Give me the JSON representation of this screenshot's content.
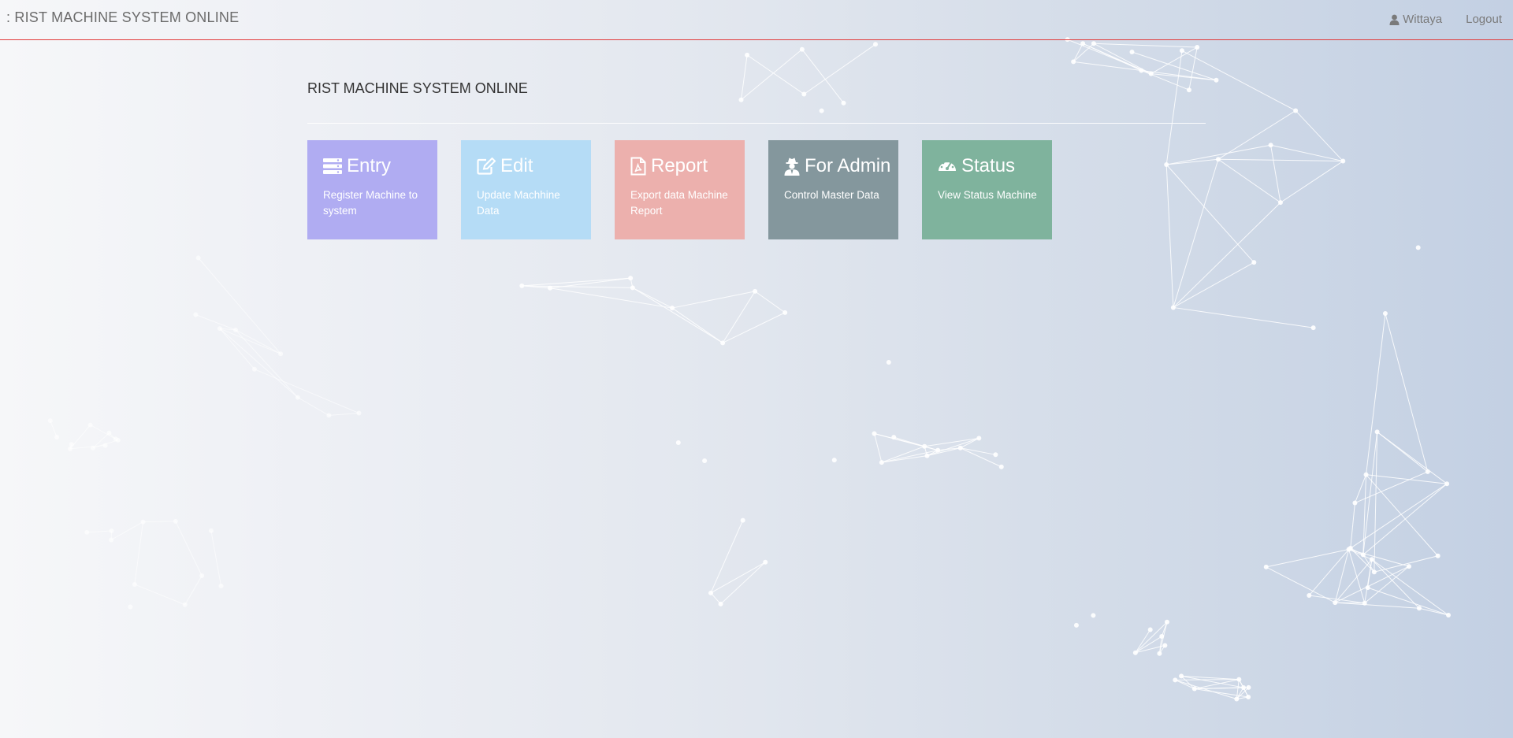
{
  "navbar": {
    "brand": ": RIST MACHINE SYSTEM ONLINE",
    "user_name": "Wittaya",
    "user_icon": "user-icon",
    "logout_label": "Logout"
  },
  "main": {
    "title": "RIST MACHINE SYSTEM ONLINE",
    "tiles": [
      {
        "title": "Entry",
        "description": "Register Machine to system",
        "icon": "server-icon",
        "color": "#b0acf2"
      },
      {
        "title": "Edit",
        "description": "Update Machhine Data",
        "icon": "edit-icon",
        "color": "#b5dcf6"
      },
      {
        "title": "Report",
        "description": "Export data Machine Report",
        "icon": "pdf-file-icon",
        "color": "#ecb0ad"
      },
      {
        "title": "For Admin",
        "description": "Control Master Data",
        "icon": "user-secret-icon",
        "color": "#84979d"
      },
      {
        "title": "Status",
        "description": "View Status Machine",
        "icon": "dashboard-icon",
        "color": "#7fb39d"
      }
    ]
  },
  "colors": {
    "navbar_border": "#e23a3a",
    "background_start": "#f6f7f9",
    "background_end": "#c3d0e3"
  }
}
